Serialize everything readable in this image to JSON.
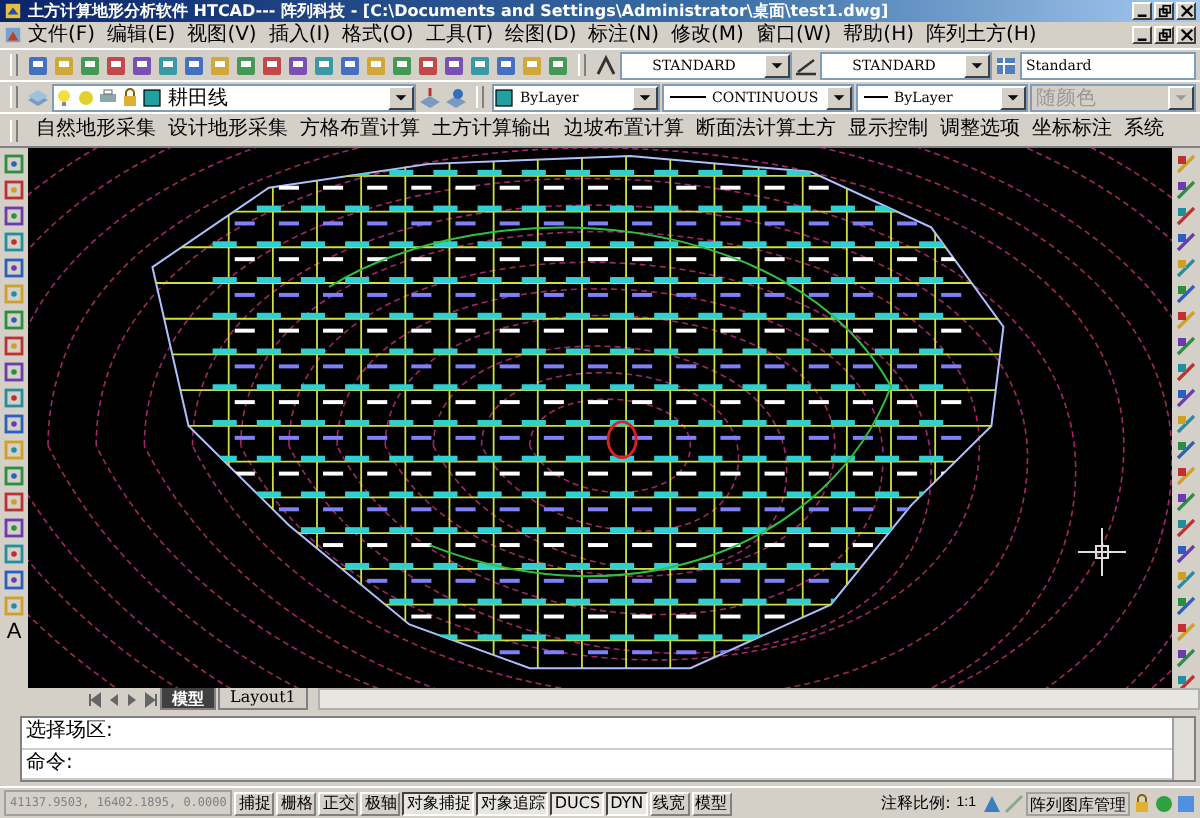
{
  "window": {
    "title": "土方计算地形分析软件 HTCAD--- 阵列科技 - [C:\\Documents and Settings\\Administrator\\桌面\\test1.dwg]"
  },
  "menu_bar": [
    "文件(F)",
    "编辑(E)",
    "视图(V)",
    "插入(I)",
    "格式(O)",
    "工具(T)",
    "绘图(D)",
    "标注(N)",
    "修改(M)",
    "窗口(W)",
    "帮助(H)",
    "阵列土方(H)"
  ],
  "styles_toolbar": {
    "text_style": "STANDARD",
    "dim_style": "STANDARD",
    "table_style": "Standard"
  },
  "layer_toolbar": {
    "layer": "耕田线",
    "color_control": "ByLayer",
    "linetype": "CONTINUOUS",
    "lineweight": "ByLayer",
    "plot_style": {
      "value": "随颜色",
      "disabled": true
    }
  },
  "custom_menu": [
    "自然地形采集",
    "设计地形采集",
    "方格布置计算",
    "土方计算输出",
    "边坡布置计算",
    "断面法计算土方",
    "显示控制",
    "调整选项",
    "坐标标注",
    "系统"
  ],
  "draw_toolbar_text_tool": "A",
  "layout_tabs": [
    {
      "label": "模型",
      "selected": true
    },
    {
      "label": "Layout1",
      "selected": false
    }
  ],
  "command_lines": [
    "选择场区:",
    "命令:"
  ],
  "status_bar": {
    "coordinates": "41137.9503, 16402.1895, 0.0000",
    "toggles": [
      {
        "label": "捕捉",
        "on": false
      },
      {
        "label": "栅格",
        "on": false
      },
      {
        "label": "正交",
        "on": false
      },
      {
        "label": "极轴",
        "on": false
      },
      {
        "label": "对象捕捉",
        "on": true
      },
      {
        "label": "对象追踪",
        "on": true
      },
      {
        "label": "DUCS",
        "on": true
      },
      {
        "label": "DYN",
        "on": true
      },
      {
        "label": "线宽",
        "on": false
      },
      {
        "label": "模型",
        "on": false
      }
    ],
    "annotation_scale_label": "注释比例:",
    "annotation_scale": "1:1",
    "library": "阵列图库管理"
  }
}
